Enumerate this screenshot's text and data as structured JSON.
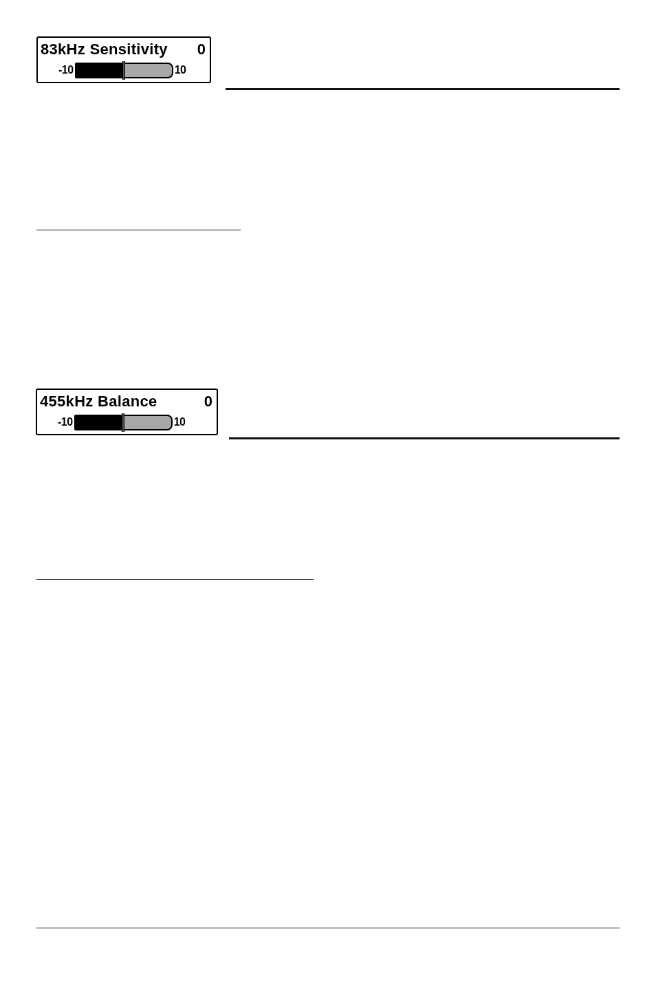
{
  "sections": [
    {
      "slider": {
        "label": "83kHz Sensitivity",
        "value": "0",
        "min": "-10",
        "max": "10",
        "level": 0.5
      }
    },
    {
      "slider": {
        "label": "455kHz Balance",
        "value": "0",
        "min": "-10",
        "max": "10",
        "level": 0.5
      }
    }
  ]
}
